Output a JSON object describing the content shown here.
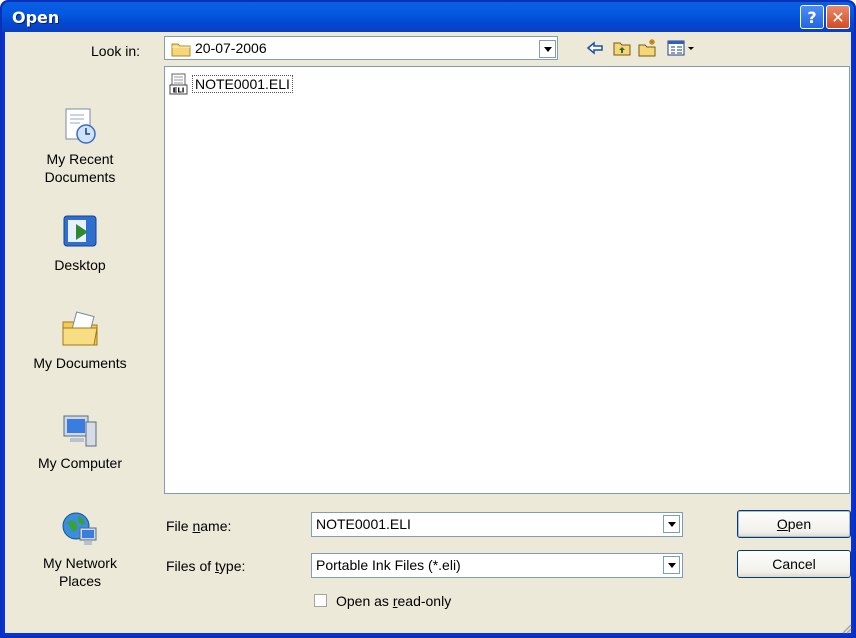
{
  "window": {
    "title": "Open",
    "help_symbol": "?",
    "close_symbol": "✕"
  },
  "look_in": {
    "label": "Look in:",
    "value": "20-07-2006"
  },
  "toolbar": {
    "icons": [
      "back-arrow-icon",
      "up-one-level-icon",
      "new-folder-icon",
      "view-menu-icon"
    ]
  },
  "places": [
    {
      "line1": "My Recent",
      "line2": "Documents",
      "icon": "recent-documents-icon"
    },
    {
      "line1": "Desktop",
      "line2": "",
      "icon": "desktop-icon"
    },
    {
      "line1": "My Documents",
      "line2": "",
      "icon": "my-documents-icon"
    },
    {
      "line1": "My Computer",
      "line2": "",
      "icon": "my-computer-icon"
    },
    {
      "line1": "My Network",
      "line2": "Places",
      "icon": "network-places-icon"
    }
  ],
  "files": [
    {
      "name": "NOTE0001.ELI",
      "icon_label": "ELI"
    }
  ],
  "file_name": {
    "label": "File name:",
    "value": "NOTE0001.ELI"
  },
  "file_type": {
    "label": "Files of type:",
    "value": "Portable Ink Files (*.eli)"
  },
  "read_only": {
    "label": "Open as read-only",
    "checked": false
  },
  "buttons": {
    "open": "Open",
    "cancel": "Cancel"
  },
  "colors": {
    "titlebar": "#0458e0",
    "dialog_bg": "#ece9d8",
    "close_button": "#d34b22"
  }
}
